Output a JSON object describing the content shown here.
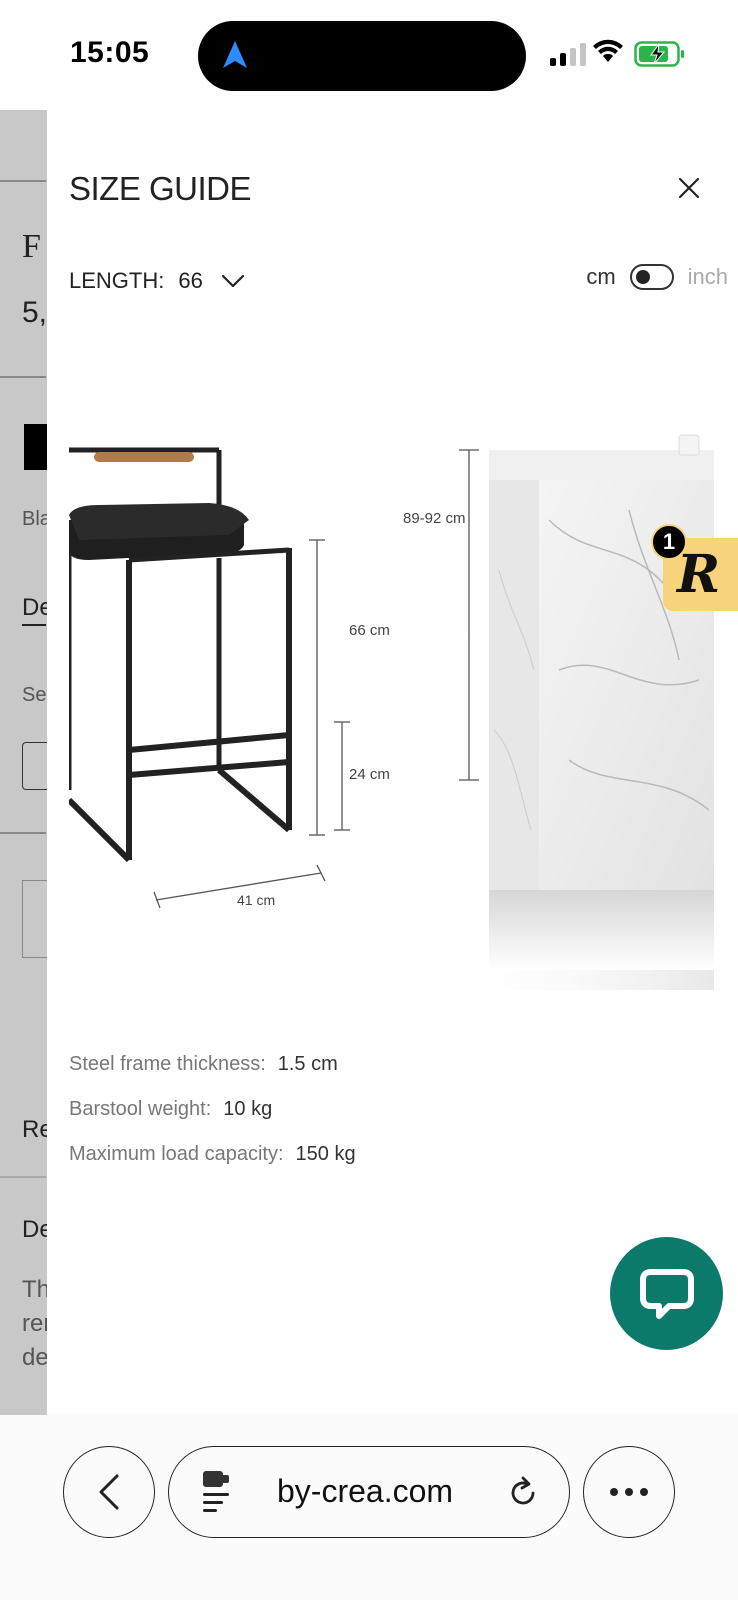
{
  "status_bar": {
    "time": "15:05"
  },
  "background_page": {
    "title_fragment": "F",
    "price_fragment": "5,",
    "color_fragment": "Bla",
    "tab_fragment": "De",
    "select_fragment": "Se",
    "reviews_fragment": "Re",
    "details_fragment": "De",
    "text_fragment_1": "Th",
    "text_fragment_2": "rer",
    "text_fragment_3": "de"
  },
  "size_guide": {
    "title": "SIZE GUIDE",
    "length_label": "LENGTH:",
    "length_value": "66",
    "unit_cm": "cm",
    "unit_inch": "inch",
    "toggle_state": "cm",
    "dimensions": {
      "seat_height": "66 cm",
      "footrest_height": "24 cm",
      "seat_width": "41 cm",
      "counter_height": "89-92 cm"
    },
    "specs": [
      {
        "label": "Steel frame thickness:",
        "value": "1.5 cm"
      },
      {
        "label": "Barstool weight:",
        "value": "10 kg"
      },
      {
        "label": "Maximum load capacity:",
        "value": "150 kg"
      }
    ]
  },
  "widget": {
    "badge_count": "1",
    "badge_letter": "R",
    "chat_icon": "chat-bubble-icon",
    "chat_color": "#0c7a6a",
    "badge_color": "#f7d47c"
  },
  "browser": {
    "url": "by-crea.com"
  }
}
